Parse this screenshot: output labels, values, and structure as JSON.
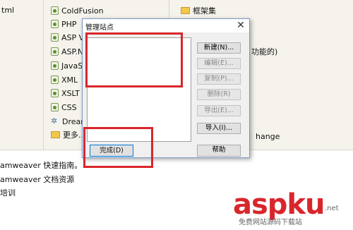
{
  "background": {
    "left_col_text": "tml",
    "center_items": [
      {
        "label": "ColdFusion",
        "icon": "file-icon"
      },
      {
        "label": "PHP",
        "icon": "file-icon"
      },
      {
        "label": "ASP V",
        "icon": "file-icon"
      },
      {
        "label": "ASP.N",
        "icon": "file-icon"
      },
      {
        "label": "JavaS",
        "icon": "file-icon"
      },
      {
        "label": "XML",
        "icon": "file-icon"
      },
      {
        "label": "XSLT",
        "icon": "file-icon"
      },
      {
        "label": "CSS",
        "icon": "file-icon"
      },
      {
        "label": "Dream",
        "icon": "dreamweaver-icon"
      },
      {
        "label": "更多...",
        "icon": "folder-icon"
      }
    ],
    "right_folder_label": "框架集",
    "right_text_1": "功能的)",
    "right_text_2": "hange",
    "bottom_links": [
      "amweaver 快速指南。",
      "amweaver 文档资源",
      "培训"
    ]
  },
  "dialog": {
    "title": "管理站点",
    "buttons": {
      "new": "新建(N)...",
      "edit": "编辑(E)...",
      "copy": "复制(P)...",
      "delete": "删除(R)",
      "export": "导出(E)...",
      "import": "导入(I)...",
      "help": "帮助",
      "done": "完成(D)"
    },
    "disabled_buttons": [
      "edit",
      "copy",
      "delete",
      "export"
    ]
  },
  "annotations": {
    "highlight_color": "#d9262b"
  },
  "watermark": {
    "brand": "aspku",
    "net": ".net",
    "tagline": "免费网站源码下载站"
  }
}
